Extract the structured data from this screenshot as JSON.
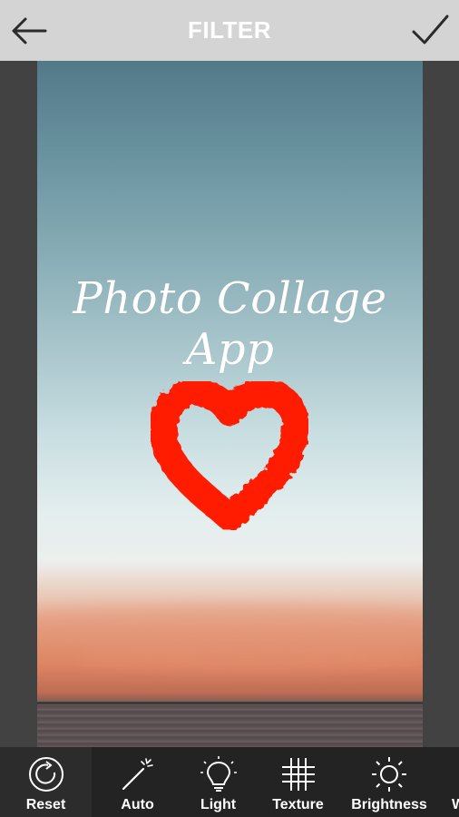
{
  "header": {
    "title": "FILTER",
    "back_icon": "arrow-left-icon",
    "confirm_icon": "checkmark-icon"
  },
  "photo": {
    "caption": "Photo Collage App",
    "sticker": "red-heart",
    "colors": {
      "heart": "#ff1a00",
      "sky_top": "#527988",
      "sunset": "#dd8463"
    }
  },
  "toolbar": {
    "tools": [
      {
        "label": "Reset",
        "icon": "reset-icon",
        "active": true
      },
      {
        "label": "Auto",
        "icon": "magic-wand-icon"
      },
      {
        "label": "Light",
        "icon": "lightbulb-icon"
      },
      {
        "label": "Texture",
        "icon": "grid-icon"
      },
      {
        "label": "Brightness",
        "icon": "sun-icon"
      },
      {
        "label": "W",
        "icon": ""
      }
    ]
  },
  "colors": {
    "topbar_bg": "#d4d4d4",
    "toolbar_bg": "#232323",
    "canvas_bg": "#424242"
  }
}
